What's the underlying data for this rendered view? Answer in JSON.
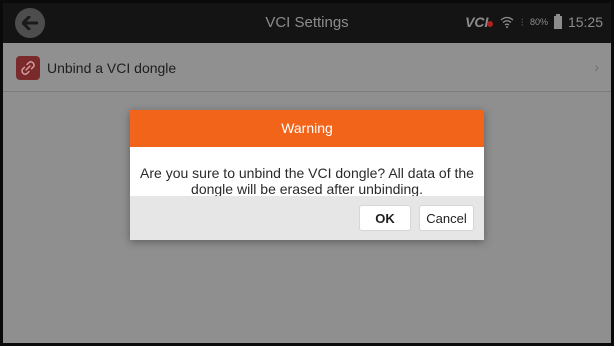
{
  "header": {
    "title": "VCI Settings",
    "back_icon": "back-arrow-icon",
    "status": {
      "vci_logo": "VCI",
      "wifi_icon": "wifi-icon",
      "battery_percent": "80%",
      "time": "15:25"
    }
  },
  "list": {
    "items": [
      {
        "label": "Unbind a VCI dongle",
        "icon": "unlink-icon",
        "chevron": "›"
      }
    ]
  },
  "dialog": {
    "title": "Warning",
    "message": "Are you sure to unbind the VCI dongle? All data of the dongle will be erased after unbinding.",
    "ok_label": "OK",
    "cancel_label": "Cancel"
  },
  "colors": {
    "accent": "#f26419",
    "overlay": "#8f8f8f",
    "topbar": "#141414",
    "unbind_icon_bg": "#7a2a2a"
  }
}
